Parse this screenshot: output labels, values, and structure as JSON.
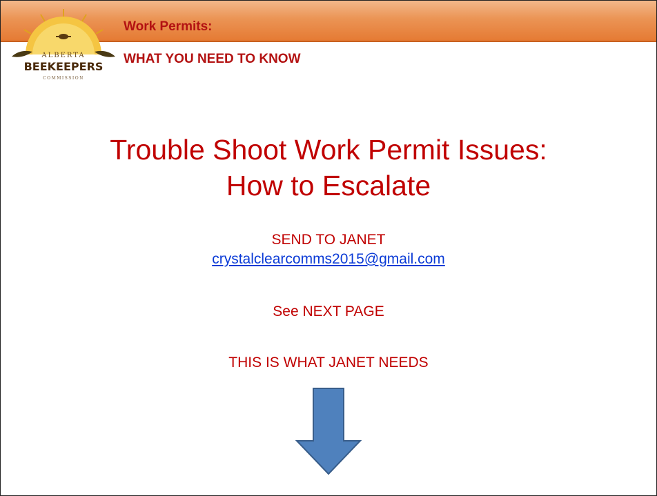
{
  "logo": {
    "brand_top": "ALBERTA",
    "brand_main": "BEEKEEPERS",
    "brand_bottom": "COMMISSION"
  },
  "header": {
    "title": "Work Permits:",
    "subtitle": "WHAT YOU NEED TO KNOW"
  },
  "main": {
    "title_line1": "Trouble Shoot Work Permit Issues:",
    "title_line2": "How to Escalate",
    "send_to": "SEND TO JANET",
    "email": "crystalclearcomms2015@gmail.com",
    "see_next": "See NEXT PAGE",
    "needs": "THIS IS WHAT JANET NEEDS"
  },
  "colors": {
    "title_red": "#c00000",
    "header_red": "#b31212",
    "link_blue": "#0b3bd6",
    "banner_orange": "#e57a33",
    "arrow_blue": "#4f81bd"
  },
  "icons": {
    "logo": "alberta-beekeepers-logo",
    "arrow": "down-arrow-icon"
  }
}
